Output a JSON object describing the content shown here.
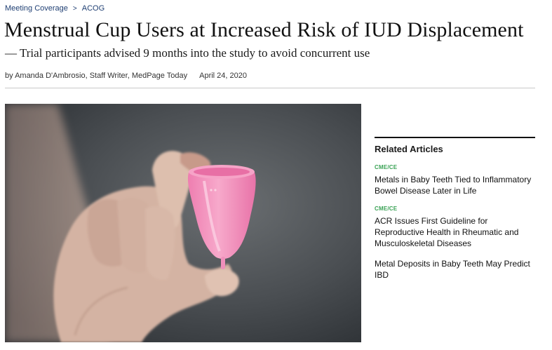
{
  "breadcrumb": {
    "section": "Meeting Coverage",
    "separator": ">",
    "event": "ACOG"
  },
  "article": {
    "title": "Menstrual Cup Users at Increased Risk of IUD Displacement",
    "subtitle": "— Trial participants advised 9 months into the study to avoid concurrent use",
    "byline": "by Amanda D'Ambrosio, Staff Writer, MedPage Today",
    "date": "April 24, 2020"
  },
  "hero_image": {
    "subject": "hand holding pink menstrual cup",
    "colors": {
      "cup": "#f28bb8",
      "background": "#4a4f53",
      "skin": "#d8b7a6"
    }
  },
  "related": {
    "heading": "Related Articles",
    "items": [
      {
        "tag": "CME/CE",
        "title": "Metals in Baby Teeth Tied to Inflammatory Bowel Disease Later in Life"
      },
      {
        "tag": "CME/CE",
        "title": "ACR Issues First Guideline for Reproductive Health in Rheumatic and Musculoskeletal Diseases"
      },
      {
        "tag": "",
        "title": "Metal Deposits in Baby Teeth May Predict IBD"
      }
    ]
  },
  "colors": {
    "link": "#1f3f73",
    "tag": "#3aa255",
    "rule": "#c8c8c8"
  }
}
